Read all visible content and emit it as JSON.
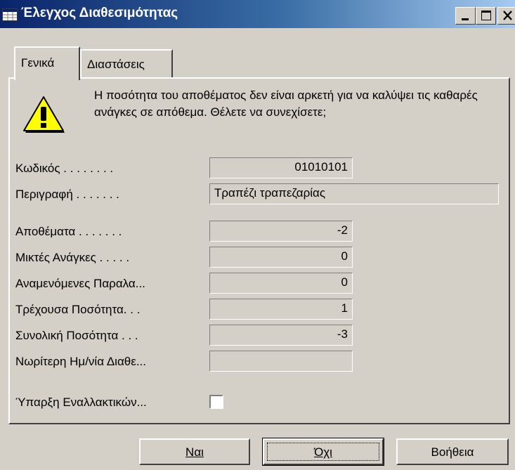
{
  "window": {
    "title": "Έλεγχος Διαθεσιμότητας",
    "icon": "table-icon"
  },
  "caption_buttons": {
    "minimize": "minimize-icon",
    "maximize": "maximize-icon",
    "close": "close-icon"
  },
  "tabs": [
    {
      "label": "Γενικά",
      "active": true
    },
    {
      "label": "Διαστάσεις",
      "active": false
    }
  ],
  "message": {
    "icon": "warning-icon",
    "text": "Η ποσότητα του αποθέματος δεν είναι αρκετή για να καλύψει τις καθαρές ανάγκες σε απόθεμα. Θέλετε να συνεχίσετε;"
  },
  "fields": {
    "code": {
      "label": "Κωδικός . . . . . . . .",
      "value": "01010101"
    },
    "description": {
      "label": "Περιγραφή . . . . . . .",
      "value": "Τραπέζι τραπεζαρίας"
    },
    "inventory": {
      "label": "Αποθέματα . . . . . . .",
      "value": "-2"
    },
    "gross_requirements": {
      "label": "Μικτές Ανάγκες . . . . .",
      "value": "0"
    },
    "scheduled_receipts": {
      "label": "Αναμενόμενες Παραλα...",
      "value": "0"
    },
    "current_quantity": {
      "label": "Τρέχουσα Ποσότητα. . .",
      "value": "1"
    },
    "total_quantity": {
      "label": "Συνολική Ποσότητα . . .",
      "value": "-3"
    },
    "earliest_availability": {
      "label": "Νωρίτερη Ημ/νία Διαθε...",
      "value": ""
    },
    "alternatives_exist": {
      "label": "Ύπαρξη Εναλλακτικών...",
      "checked": false
    }
  },
  "buttons": {
    "yes": "Ναι",
    "no": "Όχι",
    "help": "Βοήθεια"
  }
}
